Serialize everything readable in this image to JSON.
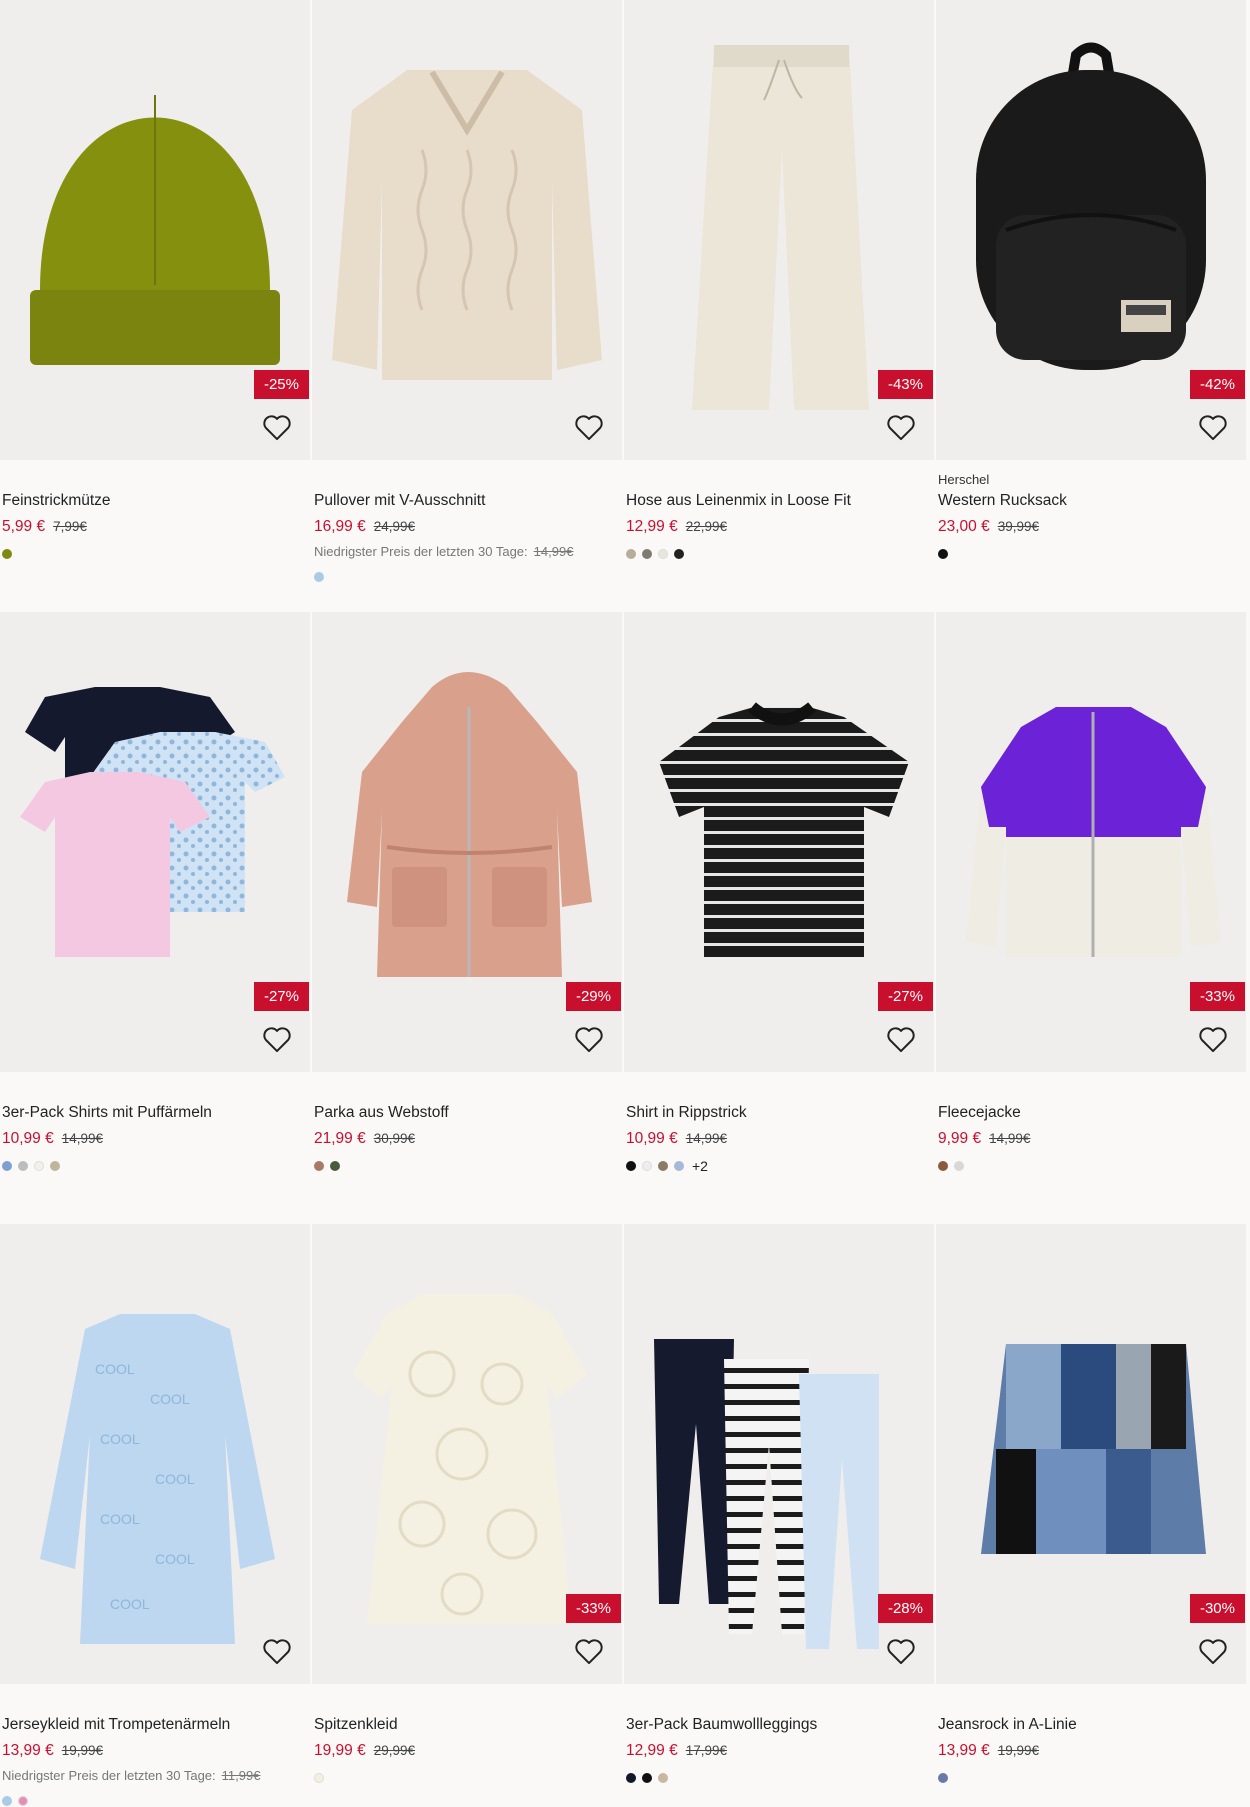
{
  "products": [
    {
      "brand": "",
      "name": "Feinstrickmütze",
      "price": "5,99 €",
      "old_price": "7,99€",
      "discount": "-25%",
      "lowest": "",
      "swatches": [
        "#7f8a10"
      ],
      "more": "",
      "art": "beanie"
    },
    {
      "brand": "",
      "name": "Pullover mit V-Ausschnitt",
      "price": "16,99 €",
      "old_price": "24,99€",
      "discount": "",
      "lowest_label": "Niedrigster Preis der letzten 30 Tage:",
      "lowest": "14,99€",
      "swatches": [
        "#a9cbe6"
      ],
      "more": "",
      "art": "sweater"
    },
    {
      "brand": "",
      "name": "Hose aus Leinenmix in Loose Fit",
      "price": "12,99 €",
      "old_price": "22,99€",
      "discount": "-43%",
      "lowest": "",
      "swatches": [
        "#b8ad98",
        "#7d7b72",
        "#e7e8da",
        "#222222"
      ],
      "more": "",
      "art": "pants"
    },
    {
      "brand": "Herschel",
      "name": "Western Rucksack",
      "price": "23,00 €",
      "old_price": "39,99€",
      "discount": "-42%",
      "lowest": "",
      "swatches": [
        "#111111"
      ],
      "more": "",
      "art": "backpack"
    },
    {
      "brand": "",
      "name": "3er-Pack Shirts mit Puffärmeln",
      "price": "10,99 €",
      "old_price": "14,99€",
      "discount": "-27%",
      "lowest": "",
      "swatches": [
        "#7e9fd0",
        "#bdbdbd",
        "#f4f1e8",
        "#bfb59e"
      ],
      "more": "",
      "art": "shirts3"
    },
    {
      "brand": "",
      "name": "Parka aus Webstoff",
      "price": "21,99 €",
      "old_price": "30,99€",
      "discount": "-29%",
      "lowest": "",
      "swatches": [
        "#a87a66",
        "#4a5a3e"
      ],
      "more": "",
      "art": "parka"
    },
    {
      "brand": "",
      "name": "Shirt in Rippstrick",
      "price": "10,99 €",
      "old_price": "14,99€",
      "discount": "-27%",
      "lowest": "",
      "swatches": [
        "#111111",
        "#eeeeee",
        "#8a7a66",
        "#a7b8d9"
      ],
      "more": "+2",
      "art": "stripeshirt"
    },
    {
      "brand": "",
      "name": "Fleecejacke",
      "price": "9,99 €",
      "old_price": "14,99€",
      "discount": "-33%",
      "lowest": "",
      "swatches": [
        "#8a5a3e",
        "#d8d8d8"
      ],
      "more": "",
      "art": "fleece"
    },
    {
      "brand": "",
      "name": "Jerseykleid mit Trompetenärmeln",
      "price": "13,99 €",
      "old_price": "19,99€",
      "discount": "",
      "lowest_label": "Niedrigster Preis der letzten 30 Tage:",
      "lowest": "11,99€",
      "swatches": [
        "#a9cbe6",
        "#e58fb5"
      ],
      "more": "",
      "art": "dressblue"
    },
    {
      "brand": "",
      "name": "Spitzenkleid",
      "price": "19,99 €",
      "old_price": "29,99€",
      "discount": "-33%",
      "lowest": "",
      "swatches": [
        "#f3f0dd"
      ],
      "more": "",
      "art": "lacedress"
    },
    {
      "brand": "",
      "name": "3er-Pack Baumwollleggings",
      "price": "12,99 €",
      "old_price": "17,99€",
      "discount": "-28%",
      "lowest": "",
      "swatches": [
        "#111827",
        "#111111",
        "#c9b7a0"
      ],
      "more": "",
      "art": "leggings"
    },
    {
      "brand": "",
      "name": "Jeansrock in A-Linie",
      "price": "13,99 €",
      "old_price": "19,99€",
      "discount": "-30%",
      "lowest": "",
      "swatches": [
        "#6a7aa8"
      ],
      "more": "",
      "art": "skirt"
    }
  ]
}
